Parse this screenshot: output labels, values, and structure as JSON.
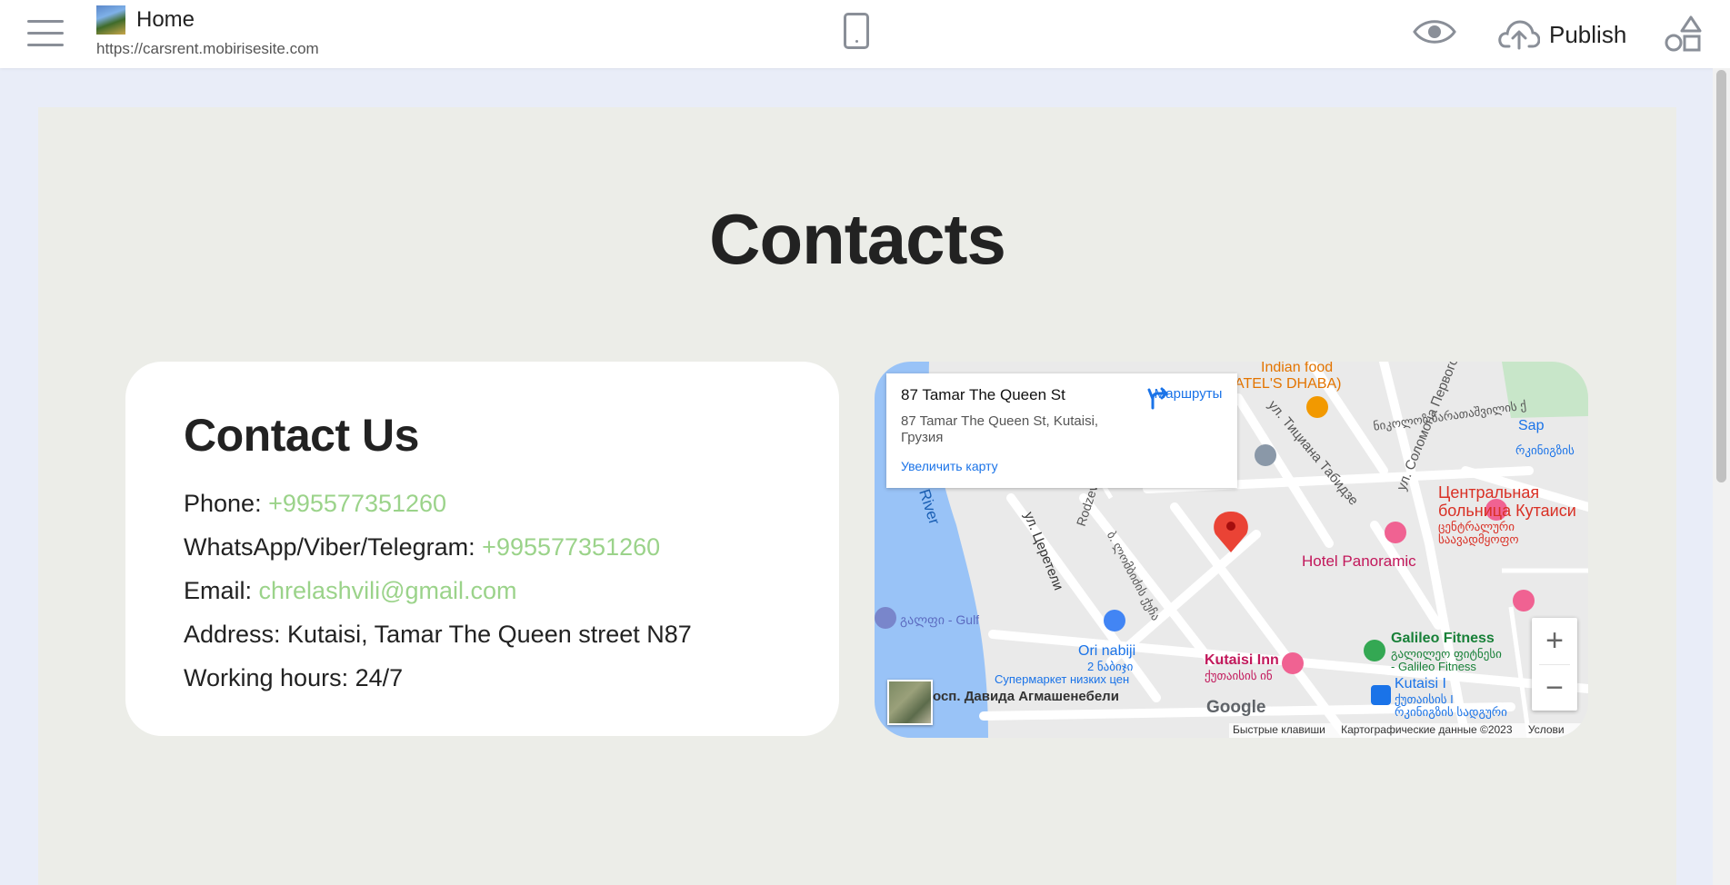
{
  "toolbar": {
    "menu_icon": "hamburger-menu-icon",
    "page_title": "Home",
    "site_url": "https://carsrent.mobirisesite.com",
    "device_icon": "mobile-phone-icon",
    "preview_icon": "eye-icon",
    "publish_label": "Publish",
    "publish_icon": "cloud-upload-icon",
    "blocks_icon": "shapes-icon"
  },
  "section": {
    "heading": "Contacts",
    "card": {
      "title": "Contact Us",
      "phone_label": "Phone:",
      "phone_value": "+995577351260",
      "messengers_label": "WhatsApp/Viber/Telegram:",
      "messengers_value": "+995577351260",
      "email_label": "Email:",
      "email_value": "chrelashvili@gmail.com",
      "address": "Address: Kutaisi, Tamar The Queen street N87",
      "hours": "Working hours: 24/7"
    },
    "link_color": "#9bd38a"
  },
  "map": {
    "info_title": "87 Tamar The Queen St",
    "info_address": "87 Tamar The Queen St, Kutaisi, Грузия",
    "routes_label": "Маршруты",
    "enlarge_label": "Увеличить карту",
    "zoom_in": "+",
    "zoom_out": "−",
    "google_label": "Google",
    "attrib": {
      "shortcuts": "Быстрые клавиши",
      "data": "Картографические данные ©2023",
      "terms": "Услови"
    },
    "labels": {
      "indian_food": "Indian food",
      "indian_food_2": "ATEL'S DHABA)",
      "river": "River",
      "tsereteli": "ул. Церетели",
      "rodzev": "Rodzev",
      "georgian_street": "ბ. ლომბიძის ქუჩა",
      "titian": "ул. Тициана Табидзе",
      "solomon": "ул. Соломона Первого",
      "hospital_ru": "Центральная",
      "hospital_ru_2": "больница Кутаиси",
      "hospital_ka": "ცენტრალური",
      "hospital_ka_2": "საავადმყოფო",
      "hotel_panoramic": "Hotel Panoramic",
      "gulf": "გალფი - Gulf",
      "ori_nabiji": "Ori nabiji",
      "ori_nabiji_ka": "2 ნაბიჯი",
      "supermarket": "Супермаркет низких цен",
      "kutaisi_inn": "Kutaisi Inn",
      "kutaisi_inn_ka": "ქუთაისის ინ",
      "galileo": "Galileo Fitness",
      "galileo_ka": "გალილეო ფიტნესი",
      "galileo_2": "- Galileo Fitness",
      "kutaisi_i": "Kutaisi I",
      "kutaisi_i_ka": "ქუთაისის I",
      "kutaisi_i_ka_2": "რკინიგზის სადგური",
      "agmashenebeli": "осп. Давида Агмашенебели",
      "railway_ka": "რკინიგზის",
      "sap": "Sap",
      "top_street": "ნიკოლოზ ბარათაშვილის ქ"
    },
    "colors": {
      "water": "#99c3f7",
      "land": "#eaeaea",
      "road": "#ffffff",
      "pin": "#ea4335"
    }
  },
  "scrollbar": {
    "label": "page-scrollbar"
  }
}
